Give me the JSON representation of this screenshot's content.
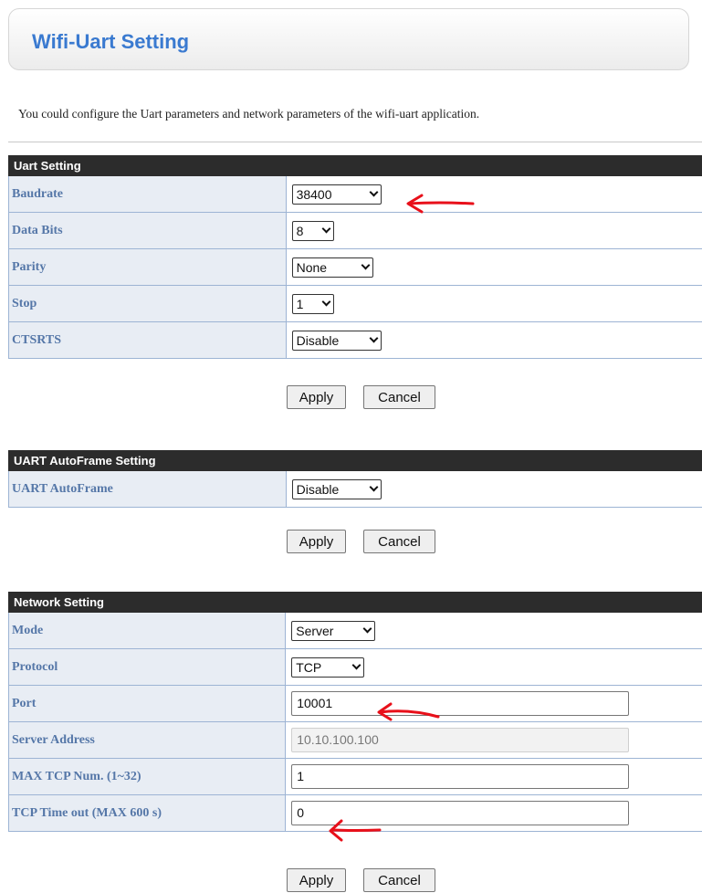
{
  "page": {
    "title": "Wifi-Uart Setting",
    "description": "You could configure the Uart parameters and network parameters of the wifi-uart application."
  },
  "uart": {
    "header": "Uart Setting",
    "rows": [
      {
        "label": "Baudrate",
        "value": "38400"
      },
      {
        "label": "Data Bits",
        "value": "8"
      },
      {
        "label": "Parity",
        "value": "None"
      },
      {
        "label": "Stop",
        "value": "1"
      },
      {
        "label": "CTSRTS",
        "value": "Disable"
      }
    ],
    "apply": "Apply",
    "cancel": "Cancel"
  },
  "autoframe": {
    "header": "UART AutoFrame Setting",
    "rows": [
      {
        "label": "UART AutoFrame",
        "value": "Disable"
      }
    ],
    "apply": "Apply",
    "cancel": "Cancel"
  },
  "network": {
    "header": "Network Setting",
    "rows": [
      {
        "label": "Mode",
        "value": "Server"
      },
      {
        "label": "Protocol",
        "value": "TCP"
      },
      {
        "label": "Port",
        "value": "10001"
      },
      {
        "label": "Server Address",
        "value": "10.10.100.100"
      },
      {
        "label": "MAX TCP Num. (1~32)",
        "value": "1"
      },
      {
        "label": "TCP Time out (MAX 600 s)",
        "value": "0"
      }
    ],
    "apply": "Apply",
    "cancel": "Cancel"
  },
  "annotation_color": "#e8101a"
}
